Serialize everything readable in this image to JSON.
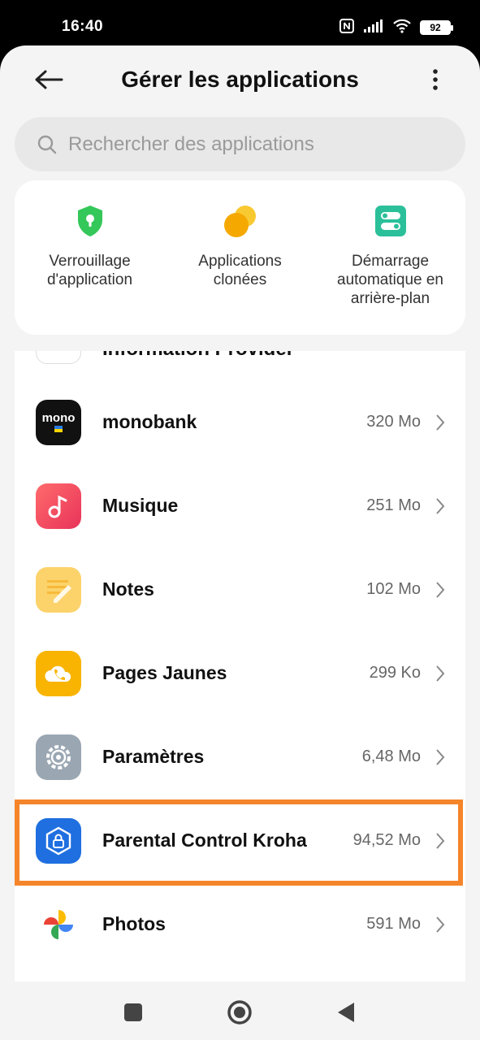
{
  "status": {
    "time": "16:40",
    "battery": "92",
    "icons": [
      "nfc-icon",
      "signal-icon",
      "wifi-icon",
      "battery-icon"
    ]
  },
  "header": {
    "title": "Gérer les applications",
    "back_icon": "arrow-left-icon",
    "more_icon": "more-vertical-icon"
  },
  "search": {
    "placeholder": "Rechercher des applications",
    "value": ""
  },
  "shortcuts": [
    {
      "label": "Verrouillage\nd'application",
      "icon": "shield-lock-icon",
      "color": "#34c759"
    },
    {
      "label": "Applications\nclonées",
      "icon": "clone-circles-icon",
      "color": "#f7b500"
    },
    {
      "label": "Démarrage\nautomatique en\narrière-plan",
      "icon": "toggle-switch-icon",
      "color": "#2bc09a"
    }
  ],
  "apps": [
    {
      "name": "Information Provider",
      "size": "",
      "partial": true
    },
    {
      "name": "monobank",
      "size": "320 Mo",
      "icon": "monobank-icon"
    },
    {
      "name": "Musique",
      "size": "251 Mo",
      "icon": "music-icon"
    },
    {
      "name": "Notes",
      "size": "102 Mo",
      "icon": "notes-icon"
    },
    {
      "name": "Pages Jaunes",
      "size": "299 Ko",
      "icon": "pages-jaunes-icon"
    },
    {
      "name": "Paramètres",
      "size": "6,48 Mo",
      "icon": "settings-gear-icon"
    },
    {
      "name": "Parental Control Kroha",
      "size": "94,52 Mo",
      "icon": "parental-control-icon",
      "highlighted": true
    },
    {
      "name": "Photos",
      "size": "591 Mo",
      "icon": "photos-pinwheel-icon"
    }
  ],
  "monobank_icon_text": "mono",
  "highlight_color": "#f5852a",
  "navbar": [
    "recents-square-icon",
    "home-circle-icon",
    "back-triangle-icon"
  ]
}
